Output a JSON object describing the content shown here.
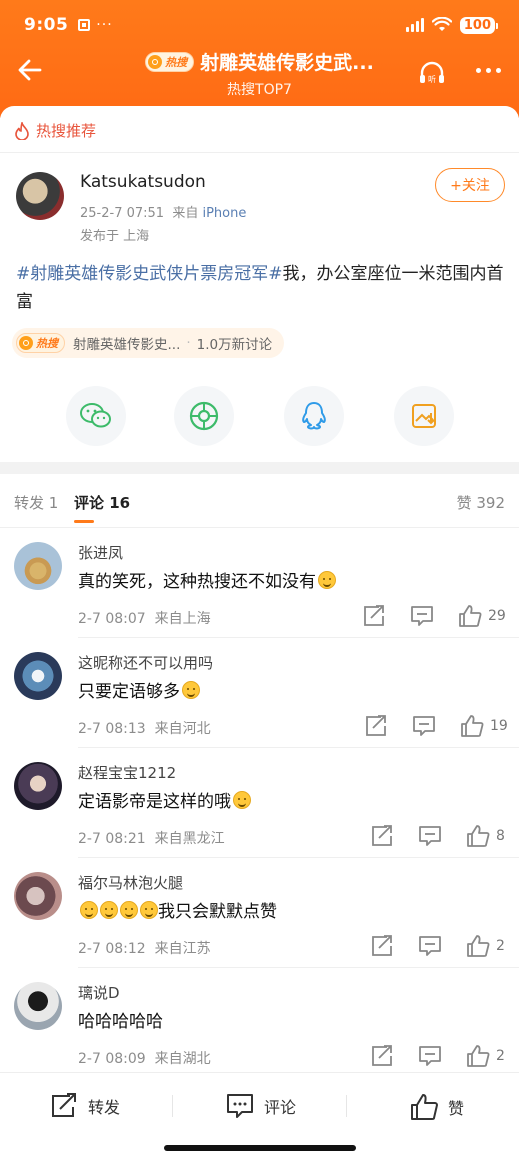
{
  "status_bar": {
    "time": "9:05",
    "battery": "100"
  },
  "nav": {
    "hot_badge": "热搜",
    "title": "射雕英雄传影史武...",
    "subtitle": "热搜TOP7"
  },
  "recommend": {
    "label": "热搜推荐"
  },
  "post": {
    "username": "Katsukatsudon",
    "datetime": "25-2-7 07:51",
    "source_prefix": "来自",
    "device": "iPhone",
    "location": "发布于 上海",
    "follow_label": "+关注",
    "topic": "#射雕英雄传影史武侠片票房冠军#",
    "text": "我，办公室座位一米范围内首富",
    "hot_topic_label": "射雕英雄传影史...",
    "hot_topic_discussion": "1.0万新讨论"
  },
  "share_targets": [
    "wechat-icon",
    "moments-icon",
    "qq-icon",
    "save-image-icon"
  ],
  "tabs": {
    "repost": "转发 1",
    "comments": "评论 16",
    "likes": "赞 392"
  },
  "comments": [
    {
      "name": "张进凤",
      "text": "真的笑死，这种热搜还不如没有",
      "emoji_count": 1,
      "time": "2-7 08:07",
      "source": "来自上海",
      "likes": "29"
    },
    {
      "name": "这昵称还不可以用吗",
      "text": "只要定语够多",
      "emoji_count": 1,
      "time": "2-7 08:13",
      "source": "来自河北",
      "likes": "19"
    },
    {
      "name": "赵程宝宝1212",
      "text": "定语影帝是这样的哦",
      "emoji_count": 1,
      "time": "2-7 08:21",
      "source": "来自黑龙江",
      "likes": "8"
    },
    {
      "name": "福尔马林泡火腿",
      "text": "我只会默默点赞",
      "emoji_count": 4,
      "time": "2-7 08:12",
      "source": "来自江苏",
      "likes": "2"
    },
    {
      "name": "璃说D",
      "text": "哈哈哈哈哈",
      "emoji_count": 0,
      "time": "2-7 08:09",
      "source": "来自湖北",
      "likes": "2"
    }
  ],
  "bottom_bar": {
    "repost": "转发",
    "comment": "评论",
    "like": "赞"
  },
  "colors": {
    "brand_orange": "#ff6a14",
    "topic_blue": "#4a6fa5",
    "hot_red": "#e8553c"
  }
}
